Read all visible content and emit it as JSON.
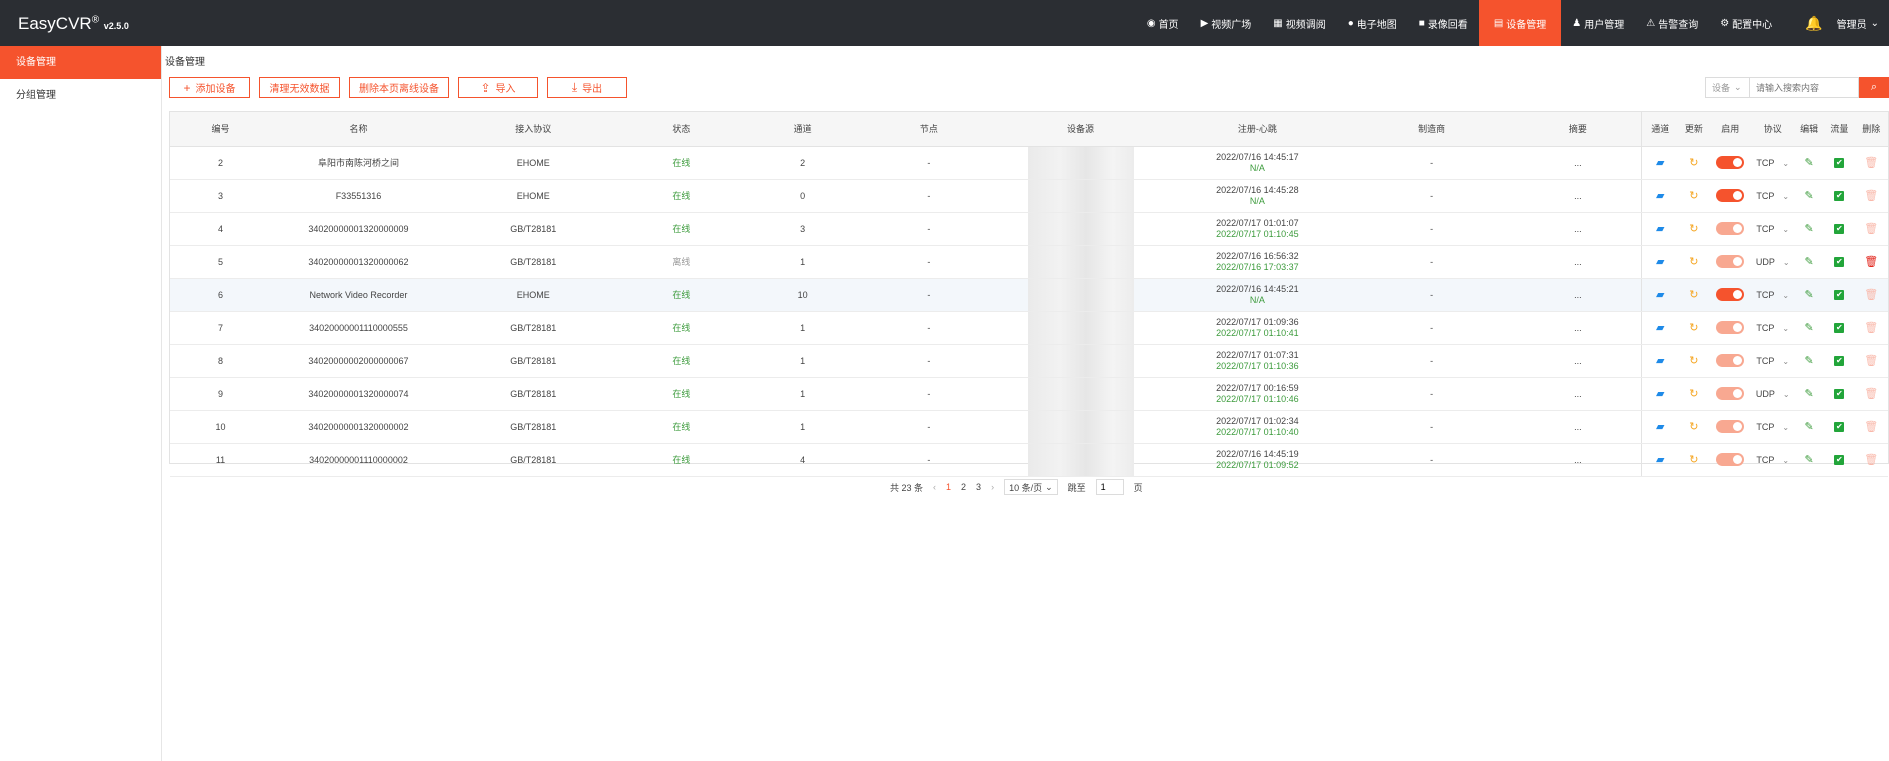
{
  "app": {
    "name": "EasyCVR",
    "reg": "®",
    "version": "v2.5.0"
  },
  "nav": {
    "items": [
      {
        "icon": "dashboard-icon",
        "glyph": "◉",
        "label": "首页"
      },
      {
        "icon": "play-icon",
        "glyph": "▶",
        "label": "视频广场"
      },
      {
        "icon": "grid-icon",
        "glyph": "▦",
        "label": "视频调阅"
      },
      {
        "icon": "map-pin-icon",
        "glyph": "●",
        "label": "电子地图"
      },
      {
        "icon": "video-camera-icon",
        "glyph": "■",
        "label": "录像回看"
      },
      {
        "icon": "device-icon",
        "glyph": "▤",
        "label": "设备管理",
        "active": true
      },
      {
        "icon": "user-icon",
        "glyph": "♟",
        "label": "用户管理"
      },
      {
        "icon": "alarm-icon",
        "glyph": "⚠",
        "label": "告警查询"
      },
      {
        "icon": "gear-icon",
        "glyph": "⚙",
        "label": "配置中心"
      }
    ],
    "user_label": "管理员"
  },
  "sidebar": {
    "items": [
      {
        "label": "设备管理",
        "active": true
      },
      {
        "label": "分组管理"
      }
    ]
  },
  "breadcrumb": "设备管理",
  "toolbar": {
    "add_label": "添加设备",
    "clean_label": "清理无效数据",
    "delete_offline_label": "删除本页离线设备",
    "import_label": "导入",
    "export_label": "导出"
  },
  "search": {
    "select_label": "设备",
    "placeholder": "请输入搜索内容"
  },
  "table": {
    "headers": [
      "编号",
      "名称",
      "接入协议",
      "状态",
      "通道",
      "节点",
      "设备源",
      "注册-心跳",
      "制造商",
      "摘要",
      "通道",
      "更新",
      "启用",
      "协议",
      "编辑",
      "流量",
      "删除"
    ],
    "rows": [
      {
        "id": "2",
        "name": "阜阳市南陈河桥之间",
        "protocol": "EHOME",
        "status": "在线",
        "channels": "2",
        "node": "-",
        "register": "2022/07/16 14:45:17",
        "heartbeat": "N/A",
        "maker": "-",
        "summary": "...",
        "transport": "TCP",
        "enabled": true,
        "online": true
      },
      {
        "id": "3",
        "name": "F33551316",
        "protocol": "EHOME",
        "status": "在线",
        "channels": "0",
        "node": "-",
        "register": "2022/07/16 14:45:28",
        "heartbeat": "N/A",
        "maker": "-",
        "summary": "...",
        "transport": "TCP",
        "enabled": true,
        "online": true
      },
      {
        "id": "4",
        "name": "34020000001320000009",
        "protocol": "GB/T28181",
        "status": "在线",
        "channels": "3",
        "node": "-",
        "register": "2022/07/17 01:01:07",
        "heartbeat": "2022/07/17 01:10:45",
        "maker": "-",
        "summary": "...",
        "transport": "TCP",
        "enabled": false,
        "online": true
      },
      {
        "id": "5",
        "name": "34020000001320000062",
        "protocol": "GB/T28181",
        "status": "离线",
        "channels": "1",
        "node": "-",
        "register": "2022/07/16 16:56:32",
        "heartbeat": "2022/07/16 17:03:37",
        "maker": "-",
        "summary": "...",
        "transport": "UDP",
        "enabled": false,
        "online": false
      },
      {
        "id": "6",
        "name": "Network Video Recorder",
        "protocol": "EHOME",
        "status": "在线",
        "channels": "10",
        "node": "-",
        "register": "2022/07/16 14:45:21",
        "heartbeat": "N/A",
        "maker": "-",
        "summary": "...",
        "transport": "TCP",
        "enabled": true,
        "online": true,
        "highlight": true
      },
      {
        "id": "7",
        "name": "34020000001110000555",
        "protocol": "GB/T28181",
        "status": "在线",
        "channels": "1",
        "node": "-",
        "register": "2022/07/17 01:09:36",
        "heartbeat": "2022/07/17 01:10:41",
        "maker": "-",
        "summary": "...",
        "transport": "TCP",
        "enabled": false,
        "online": true
      },
      {
        "id": "8",
        "name": "34020000002000000067",
        "protocol": "GB/T28181",
        "status": "在线",
        "channels": "1",
        "node": "-",
        "register": "2022/07/17 01:07:31",
        "heartbeat": "2022/07/17 01:10:36",
        "maker": "-",
        "summary": "...",
        "transport": "TCP",
        "enabled": false,
        "online": true
      },
      {
        "id": "9",
        "name": "34020000001320000074",
        "protocol": "GB/T28181",
        "status": "在线",
        "channels": "1",
        "node": "-",
        "register": "2022/07/17 00:16:59",
        "heartbeat": "2022/07/17 01:10:46",
        "maker": "-",
        "summary": "...",
        "transport": "UDP",
        "enabled": false,
        "online": true
      },
      {
        "id": "10",
        "name": "34020000001320000002",
        "protocol": "GB/T28181",
        "status": "在线",
        "channels": "1",
        "node": "-",
        "register": "2022/07/17 01:02:34",
        "heartbeat": "2022/07/17 01:10:40",
        "maker": "-",
        "summary": "...",
        "transport": "TCP",
        "enabled": false,
        "online": true
      },
      {
        "id": "11",
        "name": "34020000001110000002",
        "protocol": "GB/T28181",
        "status": "在线",
        "channels": "4",
        "node": "-",
        "register": "2022/07/16 14:45:19",
        "heartbeat": "2022/07/17 01:09:52",
        "maker": "-",
        "summary": "...",
        "transport": "TCP",
        "enabled": false,
        "online": true
      }
    ]
  },
  "pagination": {
    "total_label": "共 23 条",
    "pages": [
      "1",
      "2",
      "3"
    ],
    "current": "1",
    "page_size": "10 条/页",
    "jump_label": "跳至",
    "jump_value": "1",
    "page_suffix": "页"
  },
  "colors": {
    "accent": "#f5532d",
    "topbar": "#2b2e33",
    "online": "#3c9b3c"
  }
}
